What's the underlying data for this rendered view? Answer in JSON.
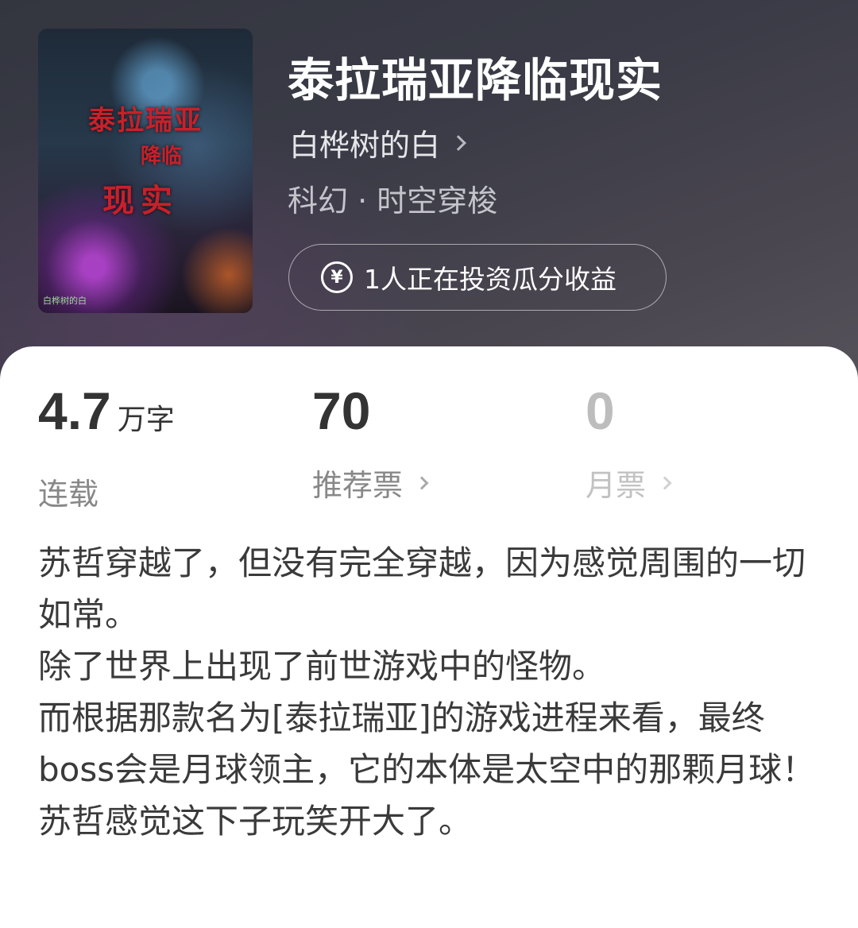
{
  "book": {
    "title": "泰拉瑞亚降临现实",
    "author": "白桦树的白",
    "genre": "科幻 · 时空穿梭",
    "invest_text": "1人正在投资瓜分收益",
    "invest_icon": "yen-circle-icon"
  },
  "cover": {
    "title_line1": "泰拉瑞亚",
    "title_line2": "降临",
    "title_line3": "现实",
    "credit": "白桦树的白"
  },
  "stats": {
    "words_value": "4.7",
    "words_unit": "万字",
    "words_label": "连载",
    "recommend_value": "70",
    "recommend_label": "推荐票",
    "monthly_value": "0",
    "monthly_label": "月票"
  },
  "synopsis": [
    "苏哲穿越了，但没有完全穿越，因为感觉周围的一切如常。",
    "除了世界上出现了前世游戏中的怪物。",
    "而根据那款名为[泰拉瑞亚]的游戏进程来看，最终boss会是月球领主，它的本体是太空中的那颗月球！",
    "苏哲感觉这下子玩笑开大了。"
  ]
}
